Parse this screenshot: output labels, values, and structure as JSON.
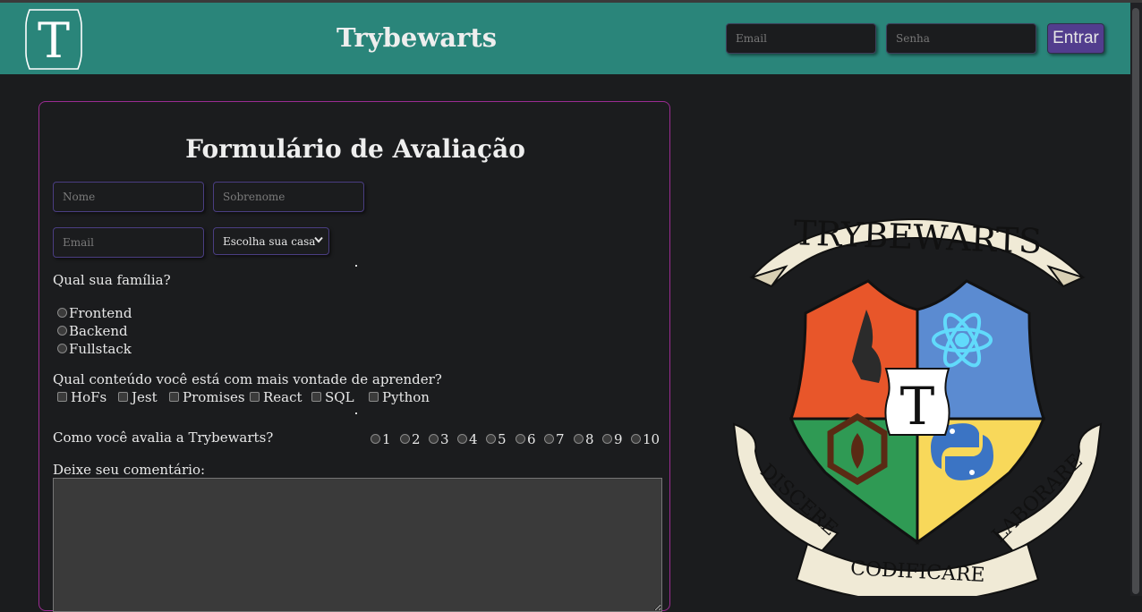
{
  "header": {
    "logo_letter": "T",
    "title": "Trybewarts",
    "email_placeholder": "Email",
    "password_placeholder": "Senha",
    "login_button": "Entrar"
  },
  "form": {
    "title": "Formulário de Avaliação",
    "name_placeholder": "Nome",
    "lastname_placeholder": "Sobrenome",
    "email_placeholder": "Email",
    "house_select": "Escolha sua casa",
    "family_question": "Qual sua família?",
    "families": [
      "Frontend",
      "Backend",
      "Fullstack"
    ],
    "content_question": "Qual conteúdo você está com mais vontade de aprender?",
    "contents": [
      "HoFs",
      "Jest",
      "Promises",
      "React",
      "SQL",
      "Python"
    ],
    "rate_question": "Como você avalia a Trybewarts?",
    "ratings": [
      "1",
      "2",
      "3",
      "4",
      "5",
      "6",
      "7",
      "8",
      "9",
      "10"
    ],
    "comment_label": "Deixe seu comentário:"
  },
  "crest": {
    "banner_top": "TRYBEWARTS",
    "center_letter": "T",
    "motto_left": "DISCERE",
    "motto_center": "CODIFICARE",
    "motto_right": "LABORARE",
    "colors": {
      "orange": "#e8562a",
      "blue": "#5b8bd1",
      "green": "#2f9a54",
      "yellow": "#f8d85a",
      "ribbon": "#f0ead6"
    }
  }
}
